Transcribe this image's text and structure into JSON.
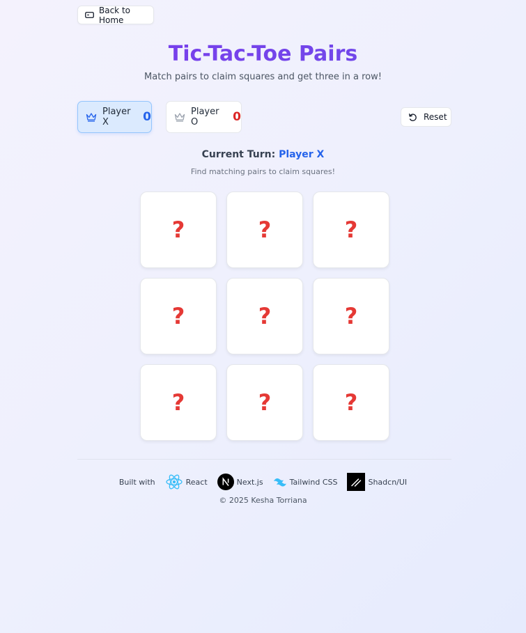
{
  "header": {
    "back_label": "Back to Home",
    "title": "Tic-Tac-Toe Pairs",
    "subtitle": "Match pairs to claim squares and get three in a row!"
  },
  "scores": {
    "x": {
      "label": "Player X",
      "value": "0"
    },
    "o": {
      "label": "Player O",
      "value": "0"
    }
  },
  "reset_label": "Reset",
  "turn": {
    "prefix": "Current Turn: ",
    "player": "Player X",
    "hint": "Find matching pairs to claim squares!"
  },
  "board": {
    "cells": [
      "?",
      "?",
      "?",
      "?",
      "?",
      "?",
      "?",
      "?",
      "?"
    ]
  },
  "footer": {
    "built_with": "Built with",
    "tech": [
      "React",
      "Next.js",
      "Tailwind CSS",
      "Shadcn/UI"
    ],
    "copyright": "© 2025 Kesha Torriana"
  },
  "colors": {
    "accent": "#7c3aed",
    "player_x": "#2563eb",
    "player_o": "#dc2626",
    "question_mark": "#e53935"
  }
}
